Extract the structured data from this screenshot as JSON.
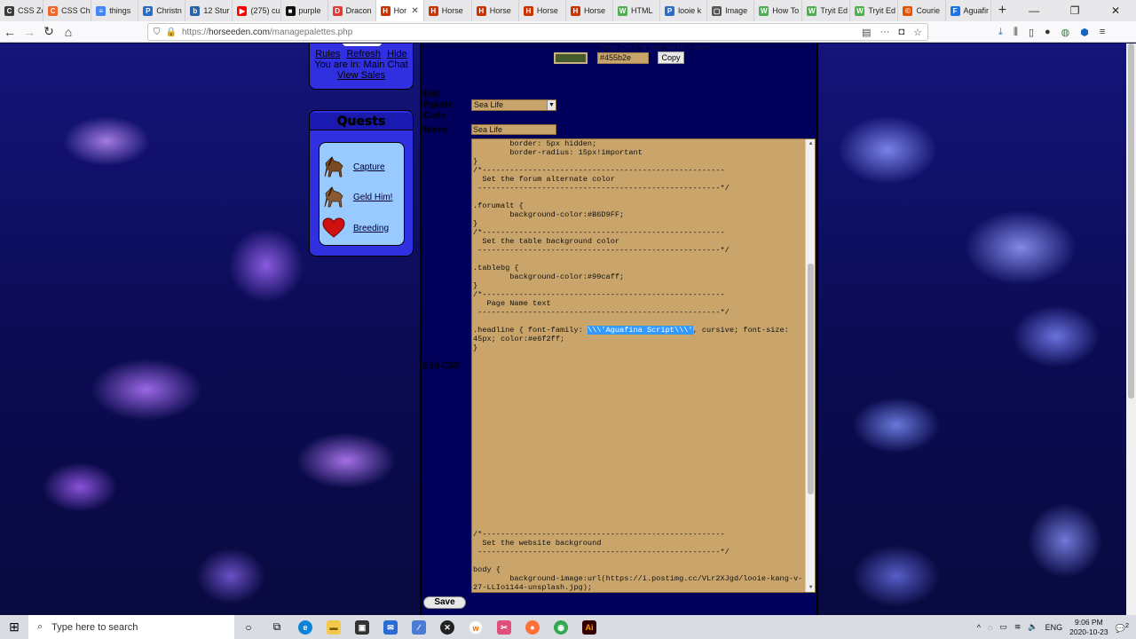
{
  "browser": {
    "tabs": [
      {
        "label": "CSS Ze",
        "color": "#3b3b3b",
        "glyph": "C"
      },
      {
        "label": "CSS Ch",
        "color": "#f06529",
        "glyph": "C"
      },
      {
        "label": "things",
        "color": "#4285f4",
        "glyph": "≡"
      },
      {
        "label": "Christn",
        "color": "#2b6cc4",
        "glyph": "P"
      },
      {
        "label": "12 Stur",
        "color": "#2a63a8",
        "glyph": "b"
      },
      {
        "label": "(275) cu",
        "color": "#ff0000",
        "glyph": "▶"
      },
      {
        "label": "purple",
        "color": "#111111",
        "glyph": "■"
      },
      {
        "label": "Dracon",
        "color": "#e53935",
        "glyph": "D"
      },
      {
        "label": "Hor",
        "color": "#cc3300",
        "glyph": "H"
      },
      {
        "label": "Horse",
        "color": "#cc3300",
        "glyph": "H"
      },
      {
        "label": "Horse",
        "color": "#cc3300",
        "glyph": "H"
      },
      {
        "label": "Horse",
        "color": "#cc3300",
        "glyph": "H"
      },
      {
        "label": "Horse",
        "color": "#cc3300",
        "glyph": "H"
      },
      {
        "label": "HTML",
        "color": "#4caf50",
        "glyph": "W"
      },
      {
        "label": "looie k",
        "color": "#2b6cc4",
        "glyph": "P"
      },
      {
        "label": "Image",
        "color": "#555555",
        "glyph": "▢"
      },
      {
        "label": "How To",
        "color": "#4caf50",
        "glyph": "W"
      },
      {
        "label": "Tryit Ed",
        "color": "#4caf50",
        "glyph": "W"
      },
      {
        "label": "Tryit Ed",
        "color": "#4caf50",
        "glyph": "W"
      },
      {
        "label": "Courie",
        "color": "#e65100",
        "glyph": "©"
      },
      {
        "label": "Aguafir",
        "color": "#1a73e8",
        "glyph": "F"
      }
    ],
    "url_scheme": "https://",
    "url_host": "horseeden.com",
    "url_path": "/managepalettes.php"
  },
  "chat_panel": {
    "rules": "Rules",
    "refresh": "Refresh",
    "hide": "Hide",
    "location": "You are in: Main Chat",
    "view_sales": "View Sales"
  },
  "quests": {
    "title": "Quests",
    "items": [
      {
        "label": "Capture",
        "icon": "horse-icon"
      },
      {
        "label": "Geld Him!",
        "icon": "horse-icon"
      },
      {
        "label": "Breeding",
        "icon": "heart-icon"
      }
    ]
  },
  "color_picker": {
    "helper": "Press Ctrl-C to copy the HEX code",
    "hex_value": "#455b2e",
    "swatch_color": "#455b2e",
    "copy_label": "Copy"
  },
  "form": {
    "edit_palette_label_1": "Edit",
    "edit_palette_label_2": "Palette",
    "code_label": "Code",
    "palette_value": "Sea Life",
    "name_label": "Name",
    "name_value": "Sea Life",
    "edit_css_label": "Edit CSS",
    "save_label": "Save"
  },
  "css_editor": {
    "lines_top": [
      "        border: 5px hidden;",
      "        border-radius: 15px!important",
      "}",
      "/*-----------------------------------------------------",
      "  Set the forum alternate color",
      " -----------------------------------------------------*/",
      "",
      ".forumalt {",
      "        background-color:#B6D9FF;",
      "}",
      "/*-----------------------------------------------------",
      "  Set the table background color",
      " -----------------------------------------------------*/",
      "",
      ".tablebg {",
      "        background-color:#99caff;",
      "}",
      "/*-----------------------------------------------------",
      "   Page Name text",
      " -----------------------------------------------------*/",
      ""
    ],
    "headline_prefix": ".headline { font-family: ",
    "headline_selected": "\\\\\\'Aguafina Script\\\\\\'",
    "headline_suffix": ", cursive; font-size: 45px; color:#e6f2ff;",
    "headline_close": "}",
    "lines_bottom": [
      "/*-----------------------------------------------------",
      "  Set the website background",
      " -----------------------------------------------------*/",
      "",
      "body {",
      "        background-image:url(https://i.postimg.cc/VLr2XJgd/looie-kang-v-27-LLIo1144-unsplash.jpg);"
    ]
  },
  "taskbar": {
    "search_placeholder": "Type here to search",
    "lang": "ENG",
    "time": "9:06 PM",
    "date": "2020-10-23",
    "notification_count": "2"
  }
}
